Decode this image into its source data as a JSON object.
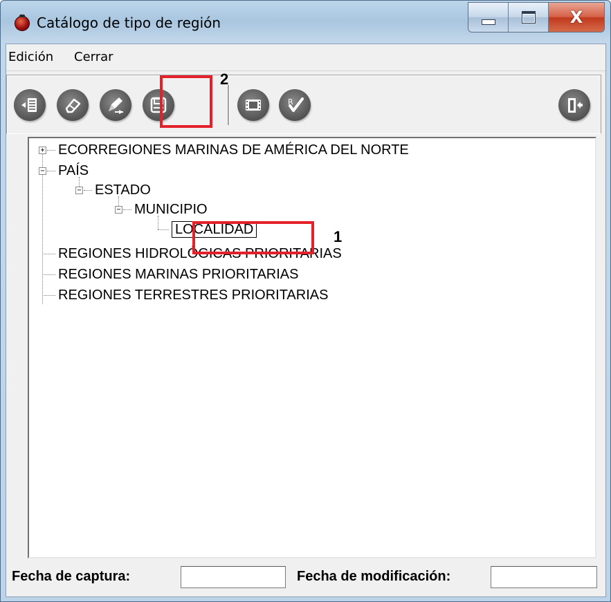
{
  "window": {
    "title": "Catálogo de tipo de región",
    "close_glyph": "X"
  },
  "menu": {
    "items": [
      "Edición",
      "Cerrar"
    ]
  },
  "toolbar": {
    "icons": [
      "new-record-icon",
      "erase-icon",
      "edit-icon",
      "save-icon",
      "film-icon",
      "check-r-icon",
      "exit-door-icon"
    ]
  },
  "tree": {
    "nodes": [
      {
        "label": "ECORREGIONES MARINAS DE AMÉRICA DEL NORTE",
        "expander": "+"
      },
      {
        "label": "PAÍS",
        "expander": "−"
      },
      {
        "label": "ESTADO",
        "expander": "−"
      },
      {
        "label": "MUNICIPIO",
        "expander": "−"
      },
      {
        "label": "LOCALIDAD"
      },
      {
        "label": "REGIONES HIDROLÓGICAS PRIORITARIAS"
      },
      {
        "label": "REGIONES MARINAS PRIORITARIAS"
      },
      {
        "label": "REGIONES TERRESTRES PRIORITARIAS"
      }
    ]
  },
  "footer": {
    "capture_label": "Fecha de captura:",
    "capture_value": "",
    "modified_label": "Fecha de modificación:",
    "modified_value": ""
  },
  "annotations": {
    "marker_1": "1",
    "marker_2": "2",
    "highlight_color": "#e4202a"
  }
}
